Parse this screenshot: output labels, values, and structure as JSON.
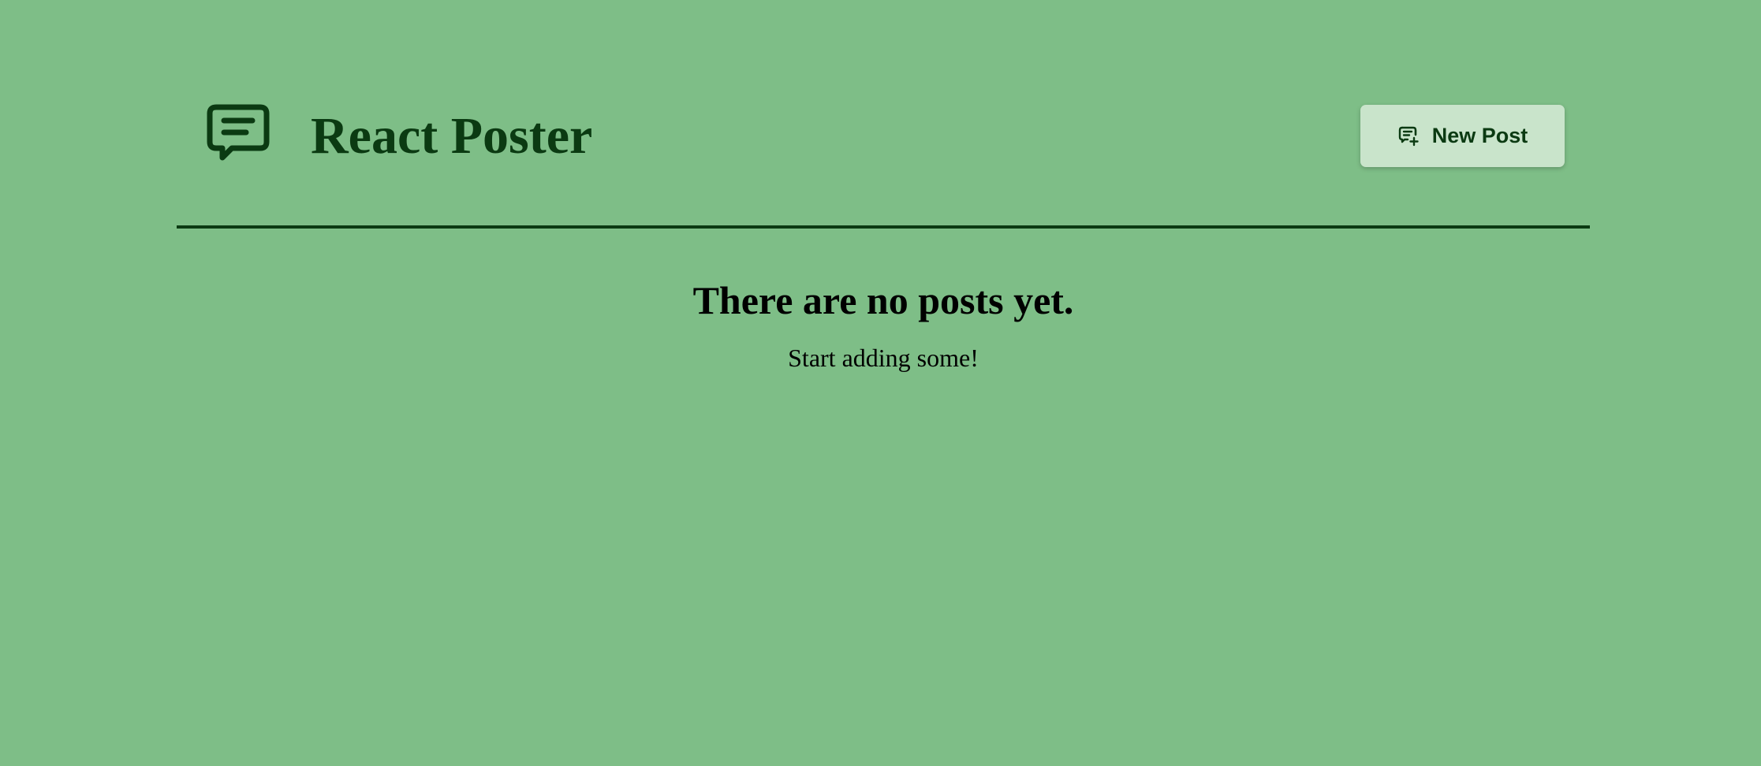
{
  "header": {
    "logo_icon": "message-square-icon",
    "title": "React Poster",
    "new_post_button": {
      "label": "New Post",
      "icon": "message-plus-icon"
    }
  },
  "main": {
    "empty_title": "There are no posts yet.",
    "empty_subtitle": "Start adding some!"
  },
  "colors": {
    "background": "#7ebe87",
    "primary_dark": "#0b3a12",
    "button_bg": "#c9e4cb"
  }
}
